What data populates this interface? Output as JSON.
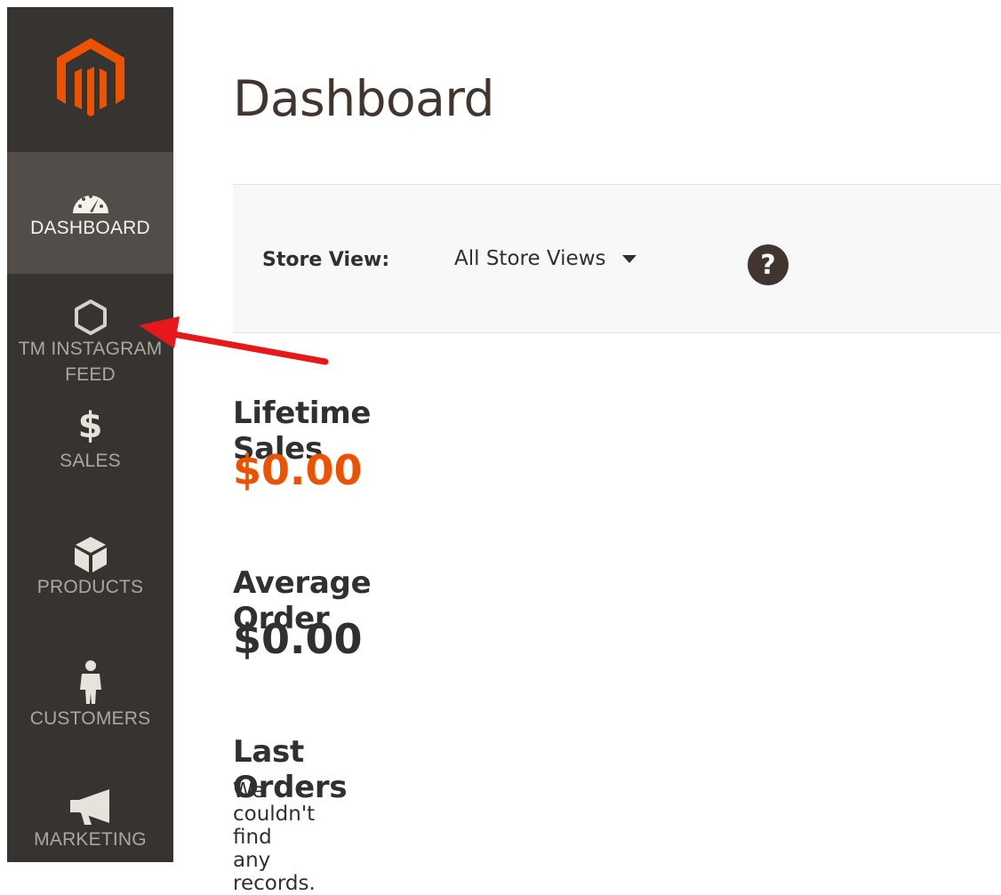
{
  "sidebar": {
    "logo_icon": "magento-logo-icon",
    "items": [
      {
        "label": "DASHBOARD",
        "icon": "speedometer-icon",
        "active": true
      },
      {
        "label": "TM INSTAGRAM FEED",
        "line1": "TM INSTAGRAM",
        "line2": "FEED",
        "icon": "hexagon-icon"
      },
      {
        "label": "SALES",
        "icon": "dollar-icon"
      },
      {
        "label": "PRODUCTS",
        "icon": "box-icon"
      },
      {
        "label": "CUSTOMERS",
        "icon": "person-icon"
      },
      {
        "label": "MARKETING",
        "icon": "megaphone-icon"
      }
    ]
  },
  "page": {
    "title": "Dashboard"
  },
  "store_view": {
    "label": "Store View:",
    "selected": "All Store Views",
    "help_icon": "question-icon"
  },
  "stats": {
    "lifetime_sales": {
      "title": "Lifetime Sales",
      "value": "$0.00"
    },
    "average_order": {
      "title": "Average Order",
      "value": "$0.00"
    }
  },
  "last_orders": {
    "title": "Last Orders",
    "empty_message": "We couldn't find any records."
  },
  "colors": {
    "sidebar_bg": "#373330",
    "sidebar_active_bg": "#524d49",
    "accent_orange": "#eb5202",
    "annotation_arrow": "#e8171b"
  }
}
